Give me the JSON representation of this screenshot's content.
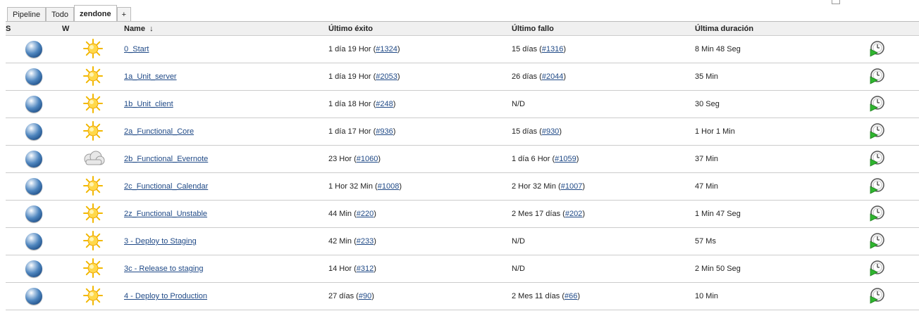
{
  "tabs": [
    "Pipeline",
    "Todo",
    "zendone",
    "+"
  ],
  "active_tab": "zendone",
  "columns": {
    "status": "S",
    "weather": "W",
    "name": "Name",
    "sort_indicator": "↓",
    "last_success": "Último éxito",
    "last_failure": "Último fallo",
    "last_duration": "Última duración"
  },
  "colors": {
    "ball": "#4f86bf",
    "link": "#204a87",
    "header_bg": "#f0f0f0"
  },
  "jobs": [
    {
      "status_icon": "blue-ball-icon",
      "weather_icon": "sunny-icon",
      "name": "0_Start",
      "success_age": "1 día 19 Hor",
      "success_build": "#1324",
      "failure_age": "15 días",
      "failure_build": "#1316",
      "duration": "8 Min 48 Seg"
    },
    {
      "status_icon": "blue-ball-icon",
      "weather_icon": "sunny-icon",
      "name": "1a_Unit_server",
      "success_age": "1 día 19 Hor",
      "success_build": "#2053",
      "failure_age": "26 días",
      "failure_build": "#2044",
      "duration": "35 Min"
    },
    {
      "status_icon": "blue-ball-icon",
      "weather_icon": "sunny-icon",
      "name": "1b_Unit_client",
      "success_age": "1 día 18 Hor",
      "success_build": "#248",
      "failure_text": "N/D",
      "duration": "30 Seg"
    },
    {
      "status_icon": "blue-ball-icon",
      "weather_icon": "sunny-icon",
      "name": "2a_Functional_Core",
      "success_age": "1 día 17 Hor",
      "success_build": "#936",
      "failure_age": "15 días",
      "failure_build": "#930",
      "duration": "1 Hor 1 Min"
    },
    {
      "status_icon": "blue-ball-icon",
      "weather_icon": "cloudy-icon",
      "name": "2b_Functional_Evernote",
      "success_age": "23 Hor",
      "success_build": "#1060",
      "failure_age": "1 día 6 Hor",
      "failure_build": "#1059",
      "duration": "37 Min"
    },
    {
      "status_icon": "blue-ball-icon",
      "weather_icon": "sunny-icon",
      "name": "2c_Functional_Calendar",
      "success_age": "1 Hor 32 Min",
      "success_build": "#1008",
      "failure_age": "2 Hor 32 Min",
      "failure_build": "#1007",
      "duration": "47 Min"
    },
    {
      "status_icon": "blue-ball-icon",
      "weather_icon": "sunny-icon",
      "name": "2z_Functional_Unstable",
      "success_age": "44 Min",
      "success_build": "#220",
      "failure_age": "2 Mes 17 días",
      "failure_build": "#202",
      "duration": "1 Min 47 Seg"
    },
    {
      "status_icon": "blue-ball-icon",
      "weather_icon": "sunny-icon",
      "name": "3 - Deploy to Staging",
      "success_age": "42 Min",
      "success_build": "#233",
      "failure_text": "N/D",
      "duration": "57 Ms"
    },
    {
      "status_icon": "blue-ball-icon",
      "weather_icon": "sunny-icon",
      "name": "3c - Release to staging",
      "success_age": "14 Hor",
      "success_build": "#312",
      "failure_text": "N/D",
      "duration": "2 Min 50 Seg"
    },
    {
      "status_icon": "blue-ball-icon",
      "weather_icon": "sunny-icon",
      "name": "4 - Deploy to Production",
      "success_age": "27 días",
      "success_build": "#90",
      "failure_age": "2 Mes 11 días",
      "failure_build": "#66",
      "duration": "10 Min"
    }
  ]
}
